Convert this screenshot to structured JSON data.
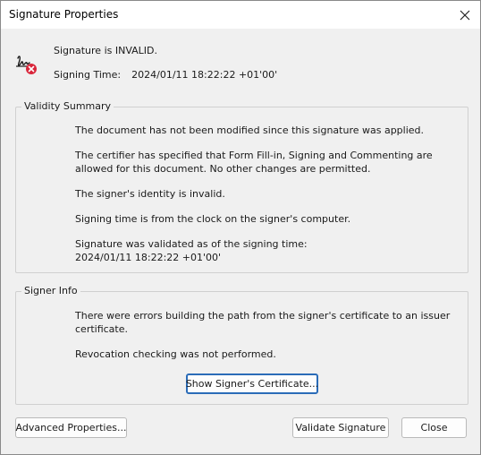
{
  "window": {
    "title": "Signature Properties"
  },
  "status": {
    "validity_text": "Signature is INVALID.",
    "signing_time_label": "Signing Time:",
    "signing_time_value": "2024/01/11 18:22:22 +01'00'"
  },
  "validity_summary": {
    "label": "Validity Summary",
    "lines": [
      "The document has not been modified since this signature was applied.",
      "The certifier has specified that Form Fill-in, Signing and Commenting are allowed for this document. No other changes are permitted.",
      "The signer's identity is invalid.",
      "Signing time is from the clock on the signer's computer.",
      "Signature was validated as of the signing time:",
      "2024/01/11 18:22:22 +01'00'"
    ]
  },
  "signer_info": {
    "label": "Signer Info",
    "lines": [
      "There were errors building the path from the signer's certificate to an issuer certificate.",
      "Revocation checking was not performed."
    ],
    "show_certificate_label": "Show Signer's Certificate..."
  },
  "footer": {
    "advanced_label": "Advanced Properties...",
    "validate_label": "Validate Signature",
    "close_label": "Close"
  },
  "icons": {
    "close": "close-icon",
    "signature_invalid": "signature-invalid-icon"
  },
  "colors": {
    "error_red": "#d9263b",
    "focus_blue": "#2b6cb8"
  }
}
